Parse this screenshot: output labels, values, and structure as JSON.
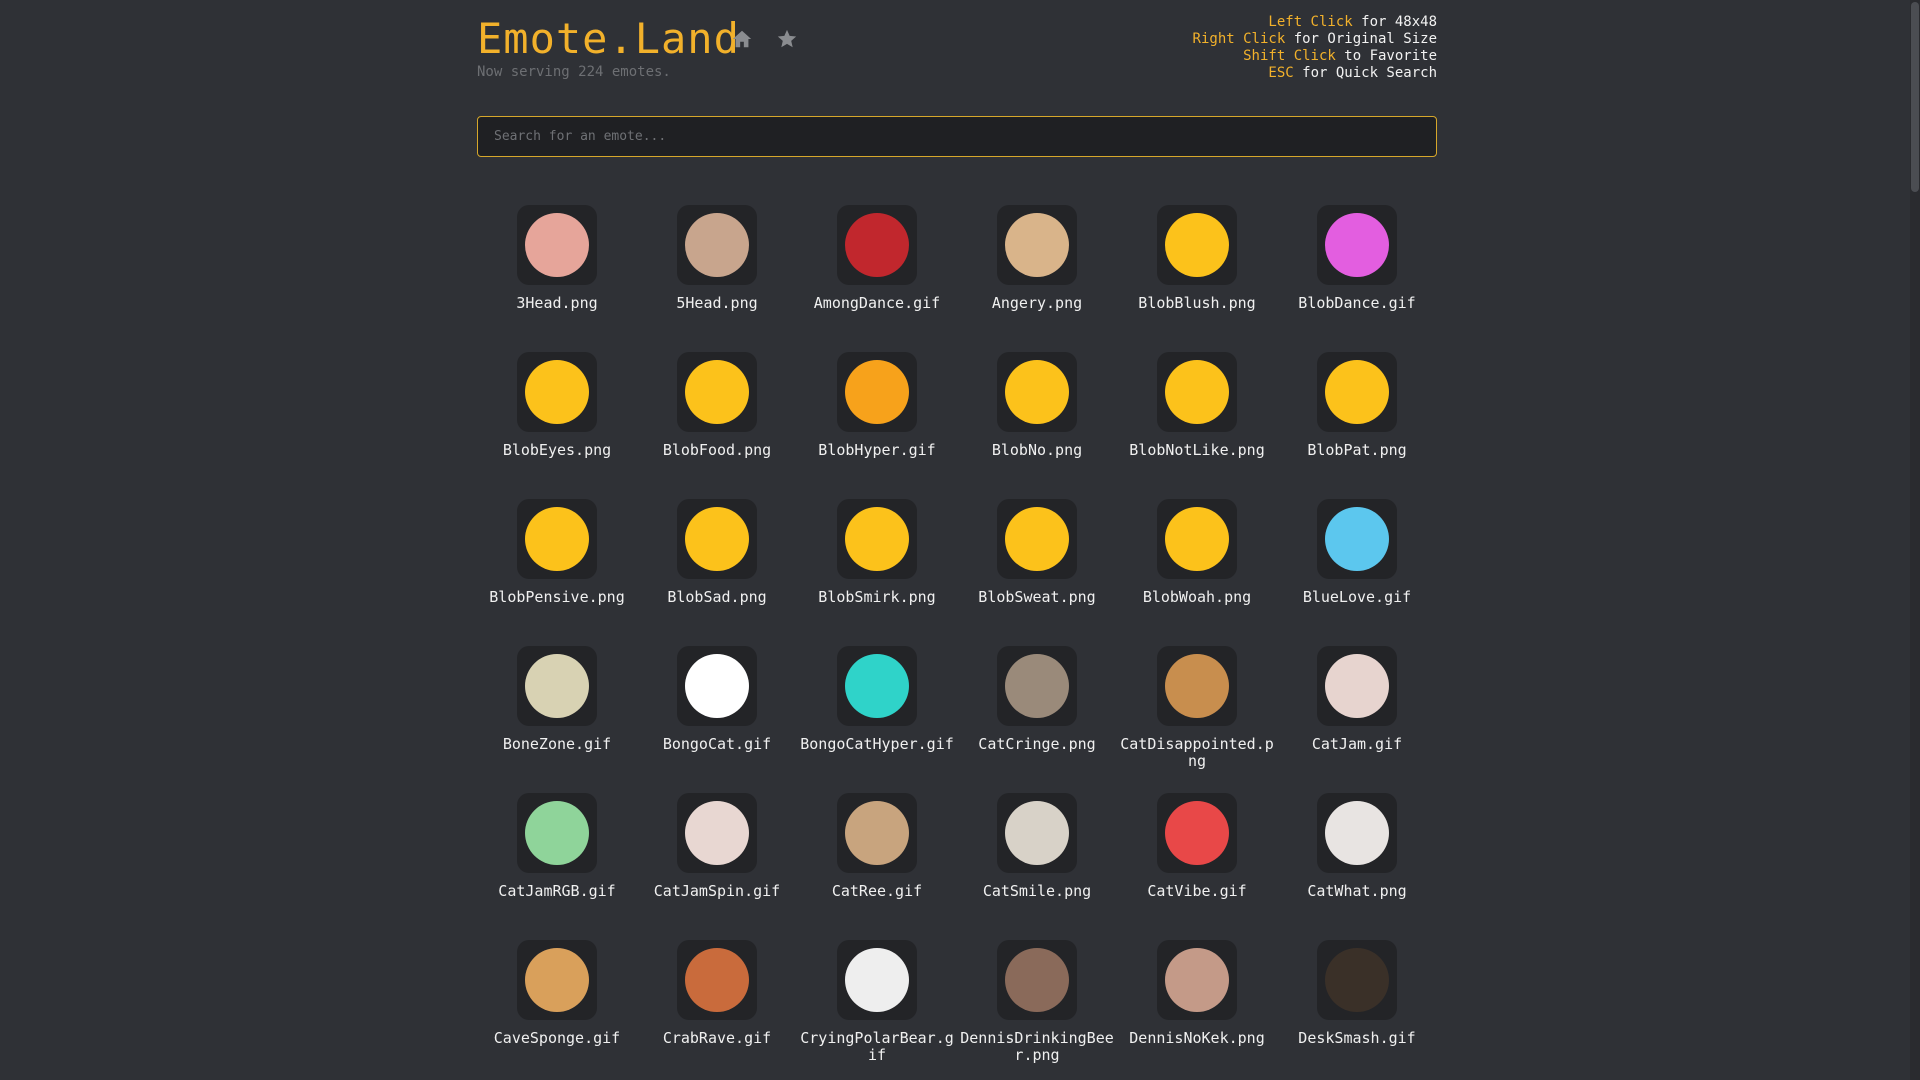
{
  "app": {
    "title": "Emote.Land",
    "subtitle": "Now serving 224 emotes.",
    "accent": "#f2b12b",
    "background": "#2f3136"
  },
  "nav": {
    "home_icon": "home-icon",
    "favorites_icon": "star-icon"
  },
  "help": [
    {
      "key": "Left Click",
      "text": "for 48x48"
    },
    {
      "key": "Right Click",
      "text": "for Original Size"
    },
    {
      "key": "Shift Click",
      "text": "to Favorite"
    },
    {
      "key": "ESC",
      "text": "for Quick Search"
    }
  ],
  "search": {
    "placeholder": "Search for an emote...",
    "value": ""
  },
  "emotes": [
    {
      "name": "3Head.png",
      "color": "#e6a59a"
    },
    {
      "name": "5Head.png",
      "color": "#c8a58d"
    },
    {
      "name": "AmongDance.gif",
      "color": "#c1272d"
    },
    {
      "name": "Angery.png",
      "color": "#d9b48a"
    },
    {
      "name": "BlobBlush.png",
      "color": "#fcc21b"
    },
    {
      "name": "BlobDance.gif",
      "color": "#e35ee0"
    },
    {
      "name": "BlobEyes.png",
      "color": "#fcc21b"
    },
    {
      "name": "BlobFood.png",
      "color": "#fcc21b"
    },
    {
      "name": "BlobHyper.gif",
      "color": "#f7a21b"
    },
    {
      "name": "BlobNo.png",
      "color": "#fcc21b"
    },
    {
      "name": "BlobNotLike.png",
      "color": "#fcc21b"
    },
    {
      "name": "BlobPat.png",
      "color": "#fcc21b"
    },
    {
      "name": "BlobPensive.png",
      "color": "#fcc21b"
    },
    {
      "name": "BlobSad.png",
      "color": "#fcc21b"
    },
    {
      "name": "BlobSmirk.png",
      "color": "#fcc21b"
    },
    {
      "name": "BlobSweat.png",
      "color": "#fcc21b"
    },
    {
      "name": "BlobWoah.png",
      "color": "#fcc21b"
    },
    {
      "name": "BlueLove.gif",
      "color": "#5cc7ee"
    },
    {
      "name": "BoneZone.gif",
      "color": "#d8d2b3"
    },
    {
      "name": "BongoCat.gif",
      "color": "#ffffff"
    },
    {
      "name": "BongoCatHyper.gif",
      "color": "#2fd3c9"
    },
    {
      "name": "CatCringe.png",
      "color": "#9a8a7a"
    },
    {
      "name": "CatDisappointed.png",
      "color": "#c88e4e"
    },
    {
      "name": "CatJam.gif",
      "color": "#e7d4cf"
    },
    {
      "name": "CatJamRGB.gif",
      "color": "#8fd49a"
    },
    {
      "name": "CatJamSpin.gif",
      "color": "#e8d7d2"
    },
    {
      "name": "CatRee.gif",
      "color": "#c8a47e"
    },
    {
      "name": "CatSmile.png",
      "color": "#d8d2c8"
    },
    {
      "name": "CatVibe.gif",
      "color": "#e84848"
    },
    {
      "name": "CatWhat.png",
      "color": "#e8e4e2"
    },
    {
      "name": "CaveSponge.gif",
      "color": "#d9a05b"
    },
    {
      "name": "CrabRave.gif",
      "color": "#c96b3c"
    },
    {
      "name": "CryingPolarBear.gif",
      "color": "#eeeeee"
    },
    {
      "name": "DennisDrinkingBeer.png",
      "color": "#8a6a5a"
    },
    {
      "name": "DennisNoKek.png",
      "color": "#c49a88"
    },
    {
      "name": "DeskSmash.gif",
      "color": "#3a3028"
    }
  ]
}
